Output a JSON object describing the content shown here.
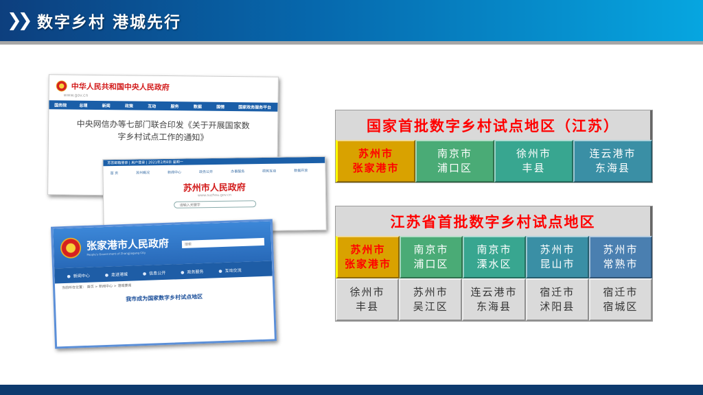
{
  "header": {
    "title": "数字乡村 港城先行",
    "icon": "double-chevron-icon"
  },
  "screenshots": {
    "central": {
      "site_name": "中华人民共和国中央人民政府",
      "url": "www.gov.cn",
      "nav": [
        "国务院",
        "总理",
        "新闻",
        "政策",
        "互动",
        "服务",
        "数据",
        "国情",
        "国家政务服务平台"
      ],
      "article_title": "中央网信办等七部门联合印发《关于开展国家数字乡村试点工作的通知》"
    },
    "suzhou": {
      "site_name": "苏州市人民政府",
      "url": "www.suzhou.gov.cn",
      "topbar": "苏苏邮箱登录 | 用户登录 | 2021年2月8日 星期一",
      "nav": [
        "首 页",
        "苏州概况",
        "新闻中心",
        "政务公开",
        "办事服务",
        "政民互动",
        "数据开放"
      ],
      "search_placeholder": "请输入关键字"
    },
    "zhangjiagang": {
      "site_name": "张家港市人民政府",
      "subtitle": "People's Government of Zhangjiagang City",
      "search_placeholder": "搜索",
      "nav": [
        "新闻中心",
        "走进港城",
        "信息公开",
        "政务服务",
        "互动交流"
      ],
      "breadcrumb": "当前所在位置： 首页 > 新闻中心 > 港城要闻",
      "article_title": "我市成为国家数字乡村试点地区"
    }
  },
  "table_national": {
    "title": "国家首批数字乡村试点地区（江苏）",
    "cells": [
      {
        "city": "苏州市",
        "district": "张家港市",
        "color": "#d9a200"
      },
      {
        "city": "南京市",
        "district": "浦口区",
        "color": "#4aab76"
      },
      {
        "city": "徐州市",
        "district": "丰县",
        "color": "#38a690"
      },
      {
        "city": "连云港市",
        "district": "东海县",
        "color": "#3a8fa5"
      }
    ]
  },
  "table_provincial": {
    "title": "江苏省首批数字乡村试点地区",
    "row1": [
      {
        "city": "苏州市",
        "district": "张家港市",
        "color": "#d9a200"
      },
      {
        "city": "南京市",
        "district": "浦口区",
        "color": "#4aab76"
      },
      {
        "city": "南京市",
        "district": "溧水区",
        "color": "#38a690"
      },
      {
        "city": "苏州市",
        "district": "昆山市",
        "color": "#3a8fa5"
      },
      {
        "city": "苏州市",
        "district": "常熟市",
        "color": "#4a7fb0"
      }
    ],
    "row2": [
      {
        "city": "徐州市",
        "district": "丰县"
      },
      {
        "city": "苏州市",
        "district": "吴江区"
      },
      {
        "city": "连云港市",
        "district": "东海县"
      },
      {
        "city": "宿迁市",
        "district": "沭阳县"
      },
      {
        "city": "宿迁市",
        "district": "宿城区"
      }
    ]
  }
}
